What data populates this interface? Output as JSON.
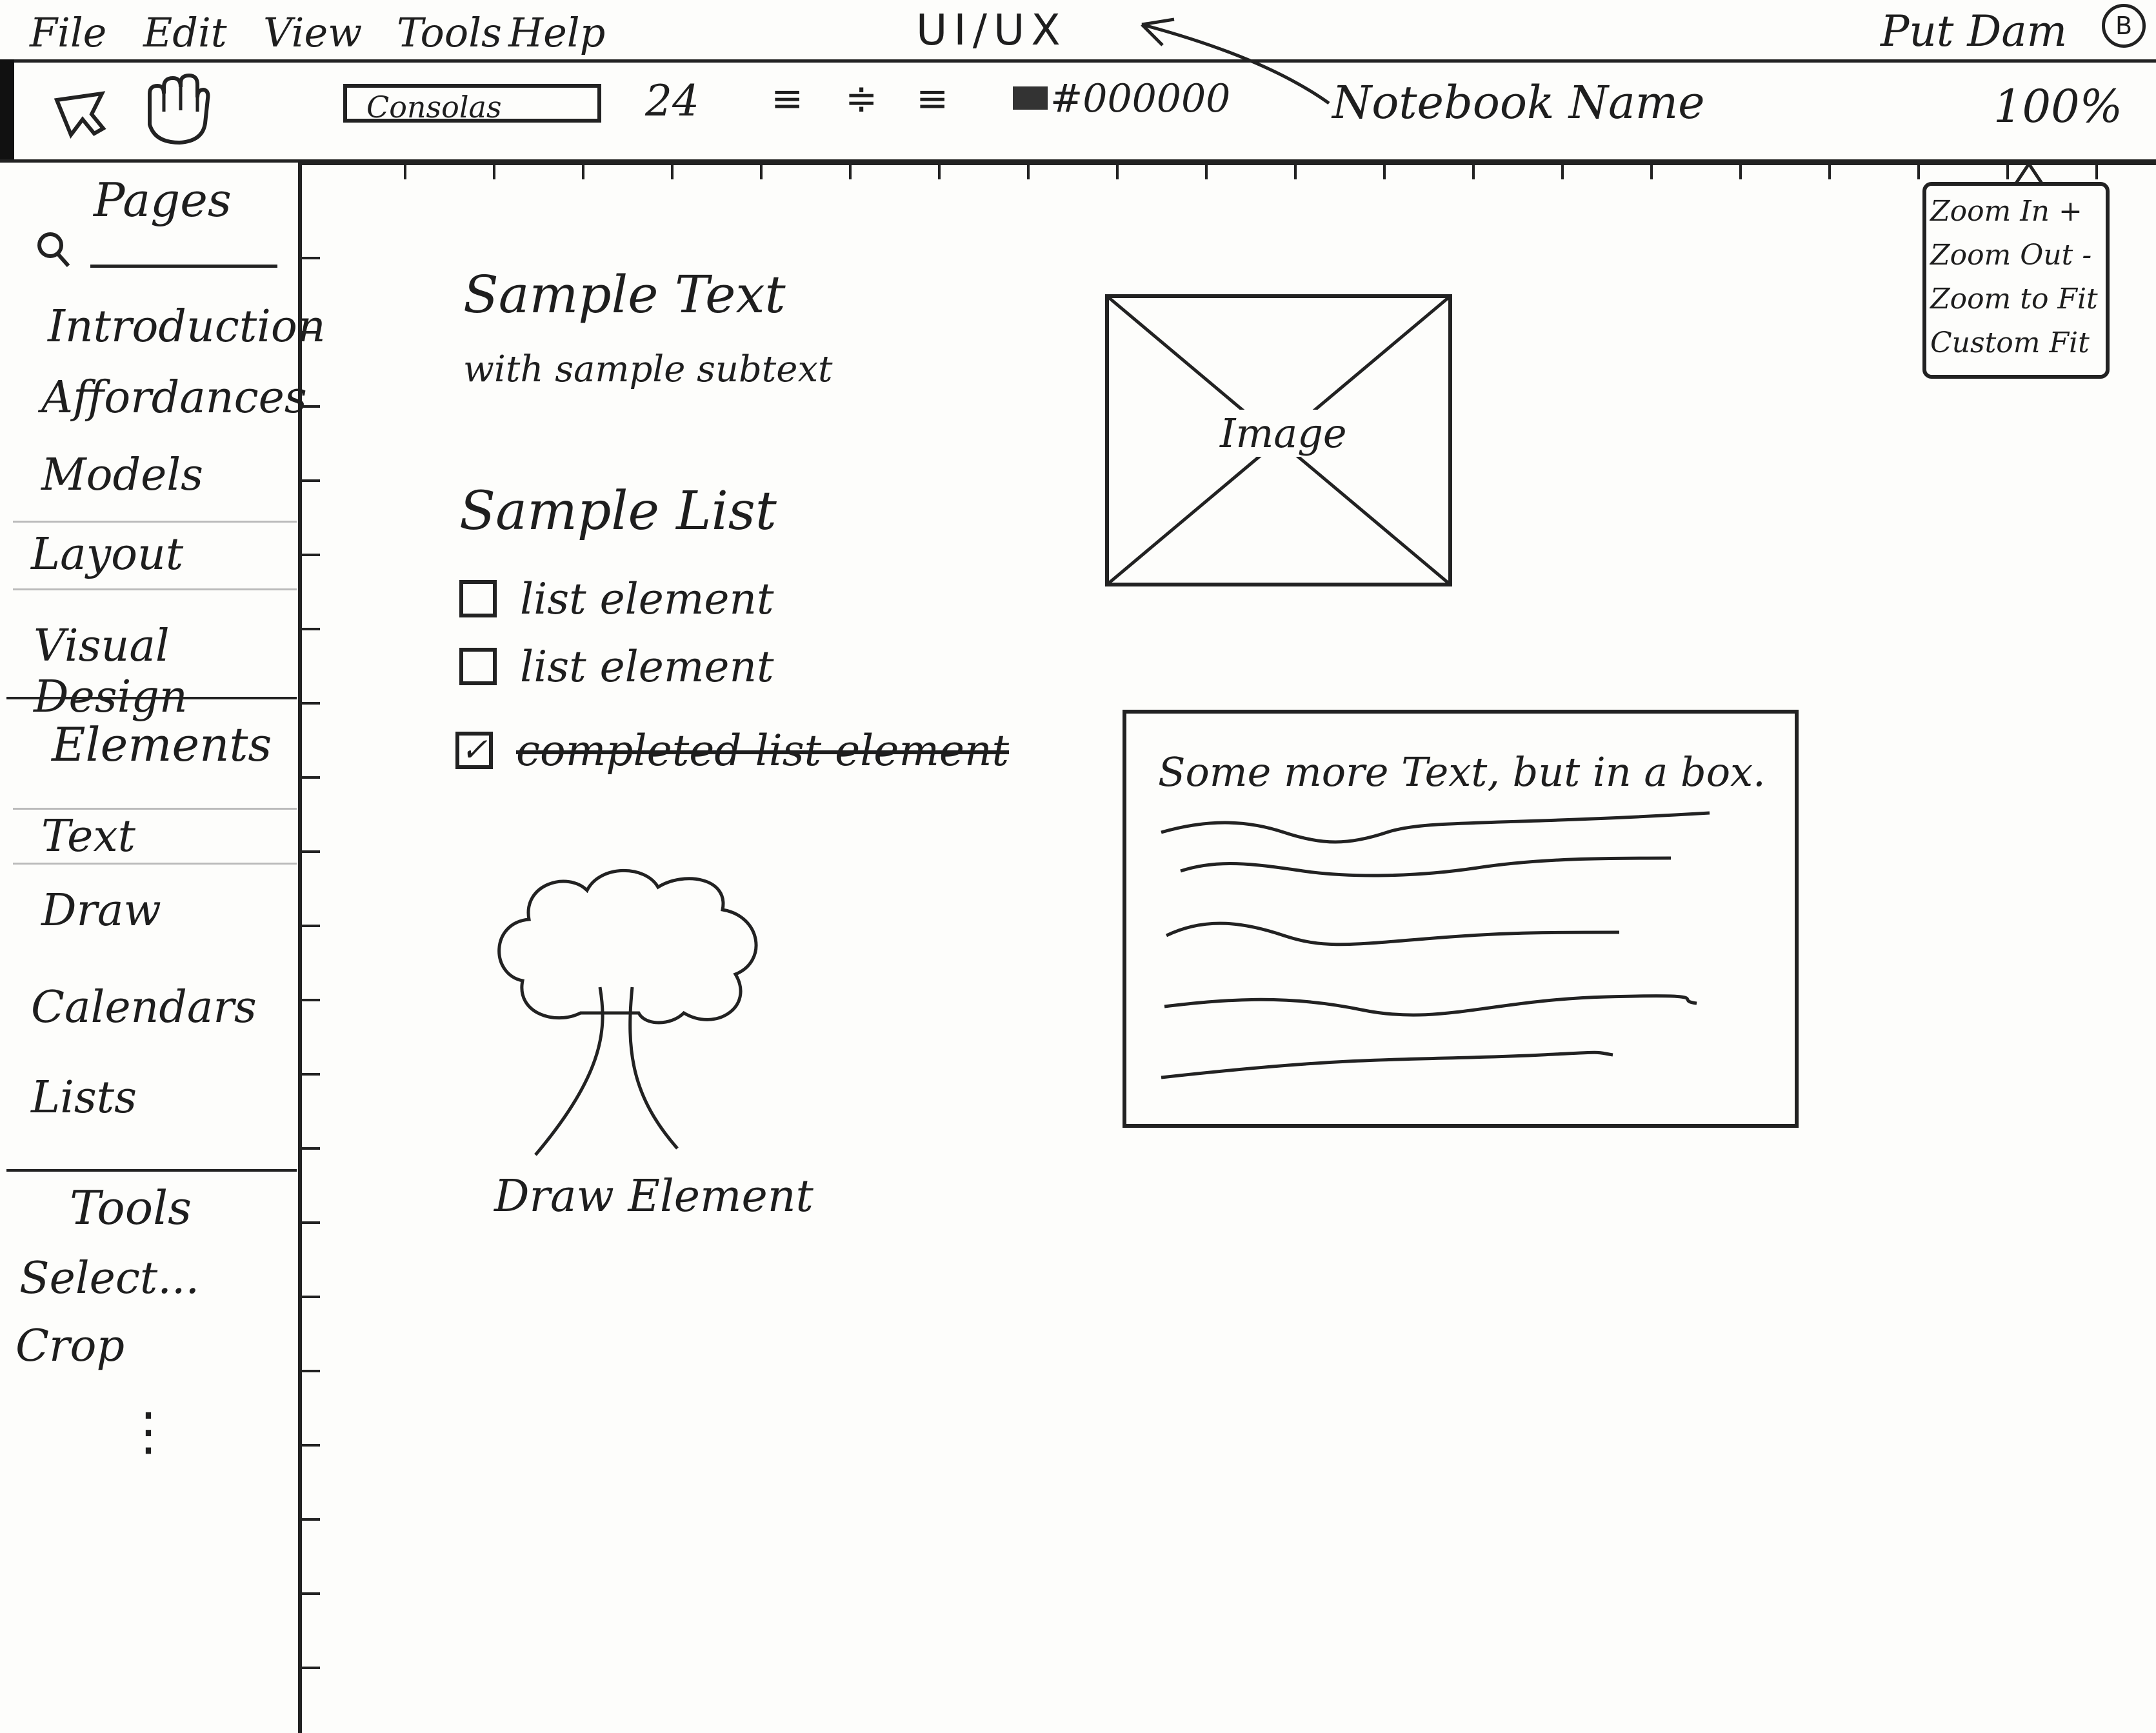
{
  "menu": {
    "items": [
      "File",
      "Edit",
      "View",
      "Tools",
      "Help"
    ]
  },
  "header": {
    "app_title": "UI/UX",
    "user_name": "Put Dam",
    "avatar": "B"
  },
  "toolbar": {
    "select_icon": "cursor-arrow-icon",
    "hand_icon": "hand-icon",
    "font_family": "Consolas",
    "font_size": "24",
    "align_left": "≡",
    "align_center": "≑",
    "align_right": "≡",
    "color_value": "#000000",
    "notebook_name": "Notebook Name",
    "zoom": "100%"
  },
  "zoom_menu": {
    "items": [
      "Zoom In +",
      "Zoom Out -",
      "Zoom to Fit",
      "Custom Fit"
    ]
  },
  "sidebar": {
    "pages_title": "Pages",
    "search_icon": "search-icon",
    "pages": [
      "Introduction",
      "Affordances",
      "Models",
      "Layout",
      "Visual Design"
    ],
    "elements_title": "Elements",
    "elements": [
      "Text",
      "Draw",
      "Calendars",
      "Lists"
    ],
    "tools_title": "Tools",
    "tools": [
      "Select...",
      "Crop"
    ],
    "more": "⋮"
  },
  "canvas": {
    "sample_text": "Sample Text",
    "sample_subtext": "with sample subtext",
    "list_title": "Sample List",
    "list_items": [
      {
        "label": "list element",
        "checked": false
      },
      {
        "label": "list element",
        "checked": false
      },
      {
        "label": "completed list element",
        "checked": true
      }
    ],
    "image_label": "Image",
    "text_box_title": "Some more Text, but in a box.",
    "draw_label": "Draw Element"
  }
}
